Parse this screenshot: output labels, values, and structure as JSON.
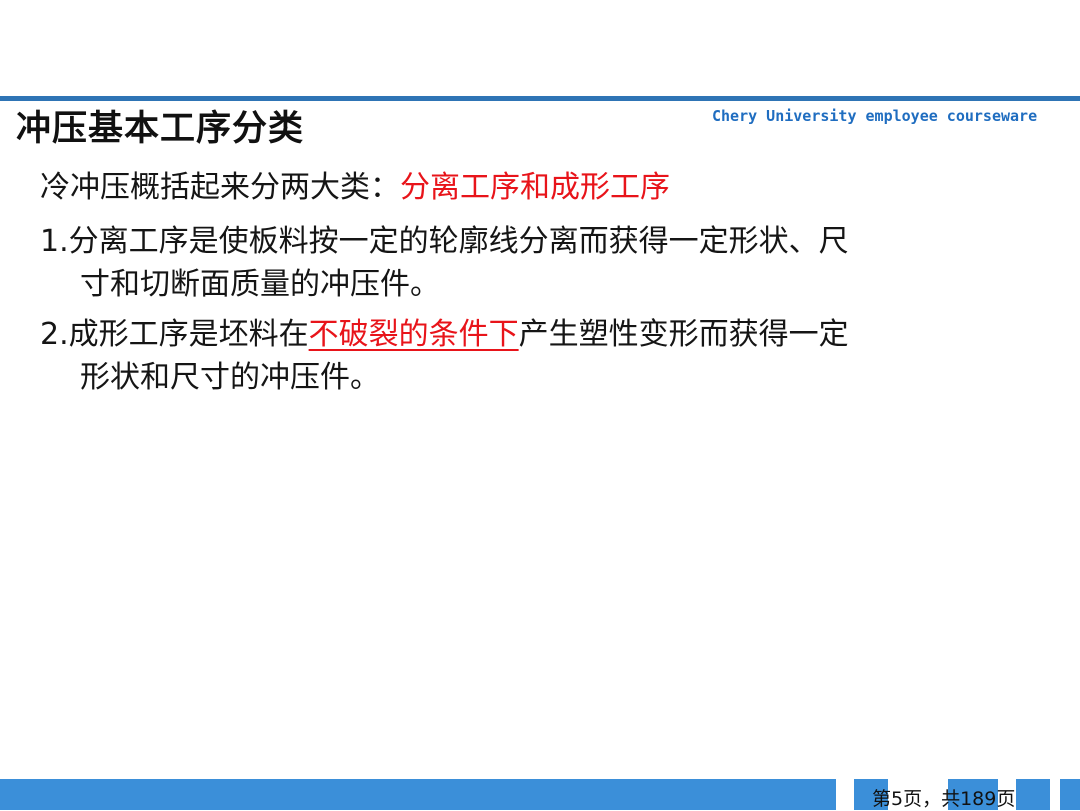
{
  "header": {
    "title": "冲压基本工序分类",
    "brand": "Chery University employee courseware"
  },
  "content": {
    "intro_prefix": "冷冲压概括起来分两大类：",
    "intro_highlight": "分离工序和成形工序",
    "item1_line1": "1.分离工序是使板料按一定的轮廓线分离而获得一定形状、尺",
    "item1_line2": "寸和切断面质量的冲压件。",
    "item2_prefix": "2.成形工序是坯料在",
    "item2_highlight": "不破裂的条件下",
    "item2_suffix": "产生塑性变形而获得一定",
    "item2_line2": "形状和尺寸的冲压件。"
  },
  "footer": {
    "page_counter": "第5页，共189页"
  },
  "colors": {
    "accent_blue": "#2e74b5",
    "brand_blue": "#1f6dc0",
    "highlight_red": "#e8141a",
    "footer_blue": "#3b8fd9"
  }
}
